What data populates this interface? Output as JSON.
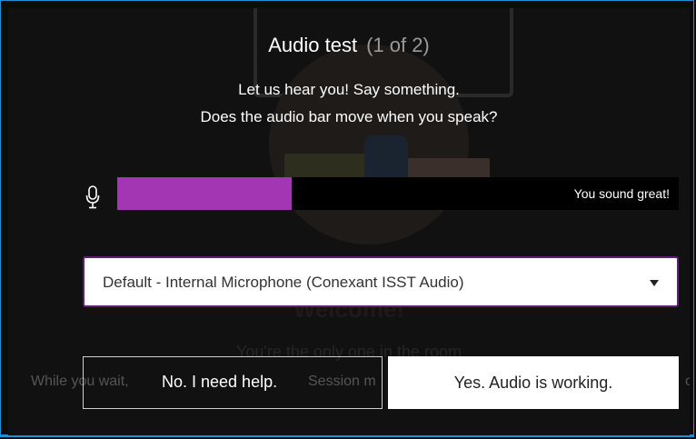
{
  "dialog": {
    "title": "Audio test",
    "step": "(1 of 2)",
    "prompt_line1": "Let us hear you! Say something.",
    "prompt_line2": "Does the audio bar move when you speak?"
  },
  "meter": {
    "level_fraction": 0.31,
    "fill_color": "#a336b3",
    "status": "You sound great!",
    "icon": "microphone-icon"
  },
  "microphone_select": {
    "selected": "Default - Internal Microphone (Conexant ISST Audio)",
    "icon": "dropdown-caret-icon"
  },
  "buttons": {
    "no": "No. I need help.",
    "yes": "Yes. Audio is working."
  },
  "background": {
    "welcome": "Welcome!",
    "only_one": "You're the only one in the room",
    "while_left": "While you wait,",
    "while_mid": "Session m",
    "while_right": "or"
  },
  "colors": {
    "border_accent": "#1e8fd8",
    "select_border": "#5e1f74"
  }
}
